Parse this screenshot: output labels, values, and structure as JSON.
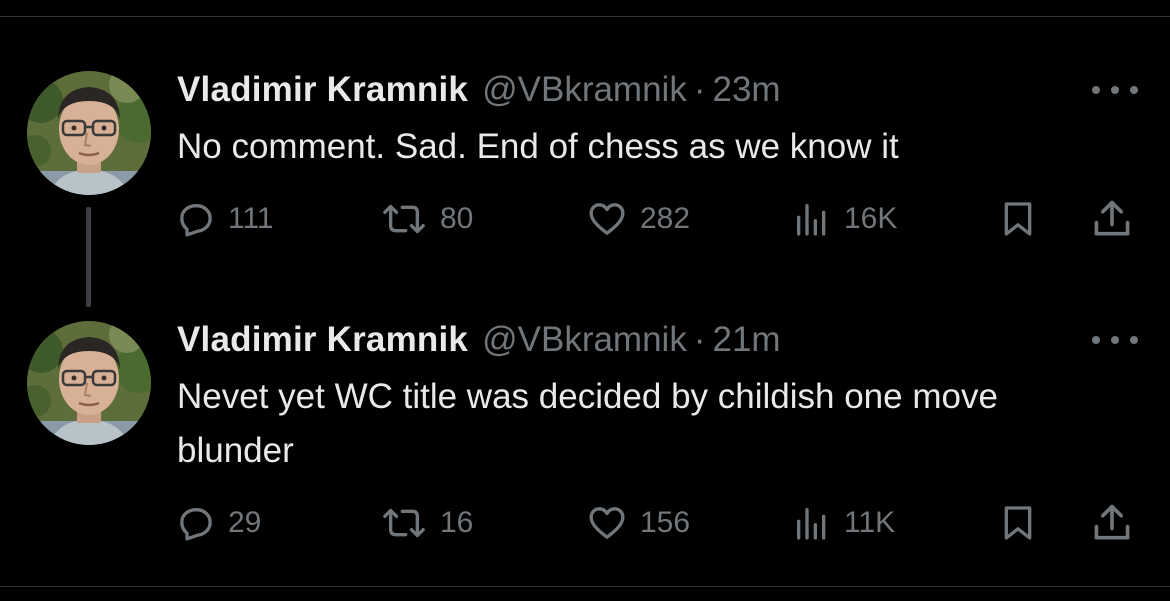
{
  "theme": {
    "background": "#000000",
    "text_primary": "#e7e9ea",
    "text_secondary": "#71767b",
    "divider": "#2f3336"
  },
  "tweets": [
    {
      "display_name": "Vladimir Kramnik",
      "handle": "@VBkramnik",
      "separator": "·",
      "time": "23m",
      "text": "No comment. Sad. End of chess as we know it",
      "avatar_icon": "user-avatar",
      "actions": {
        "replies": "111",
        "reposts": "80",
        "likes": "282",
        "views": "16K"
      }
    },
    {
      "display_name": "Vladimir Kramnik",
      "handle": "@VBkramnik",
      "separator": "·",
      "time": "21m",
      "text": "Nevet yet WC title was decided by childish one move blunder",
      "avatar_icon": "user-avatar",
      "actions": {
        "replies": "29",
        "reposts": "16",
        "likes": "156",
        "views": "11K"
      }
    }
  ],
  "icons": {
    "reply": "reply-icon",
    "repost": "repost-icon",
    "like": "heart-icon",
    "views": "views-chart-icon",
    "bookmark": "bookmark-icon",
    "share": "share-icon",
    "more": "more-options-icon"
  }
}
